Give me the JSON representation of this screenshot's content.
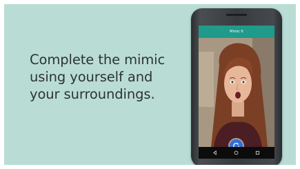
{
  "slide": {
    "headline_lines": [
      "Complete the mimic",
      "using yourself and",
      "your surroundings."
    ]
  },
  "phone": {
    "app_title": "Mimic It",
    "icons": {
      "capture": "camera-shutter-icon",
      "back": "back-triangle-icon",
      "home": "home-circle-icon",
      "recents": "recents-square-icon"
    }
  },
  "colors": {
    "background": "#b9ddd5",
    "headline_text": "#2e3236",
    "app_bar": "#1f9a8b",
    "capture_button": "#2f6fd6"
  }
}
